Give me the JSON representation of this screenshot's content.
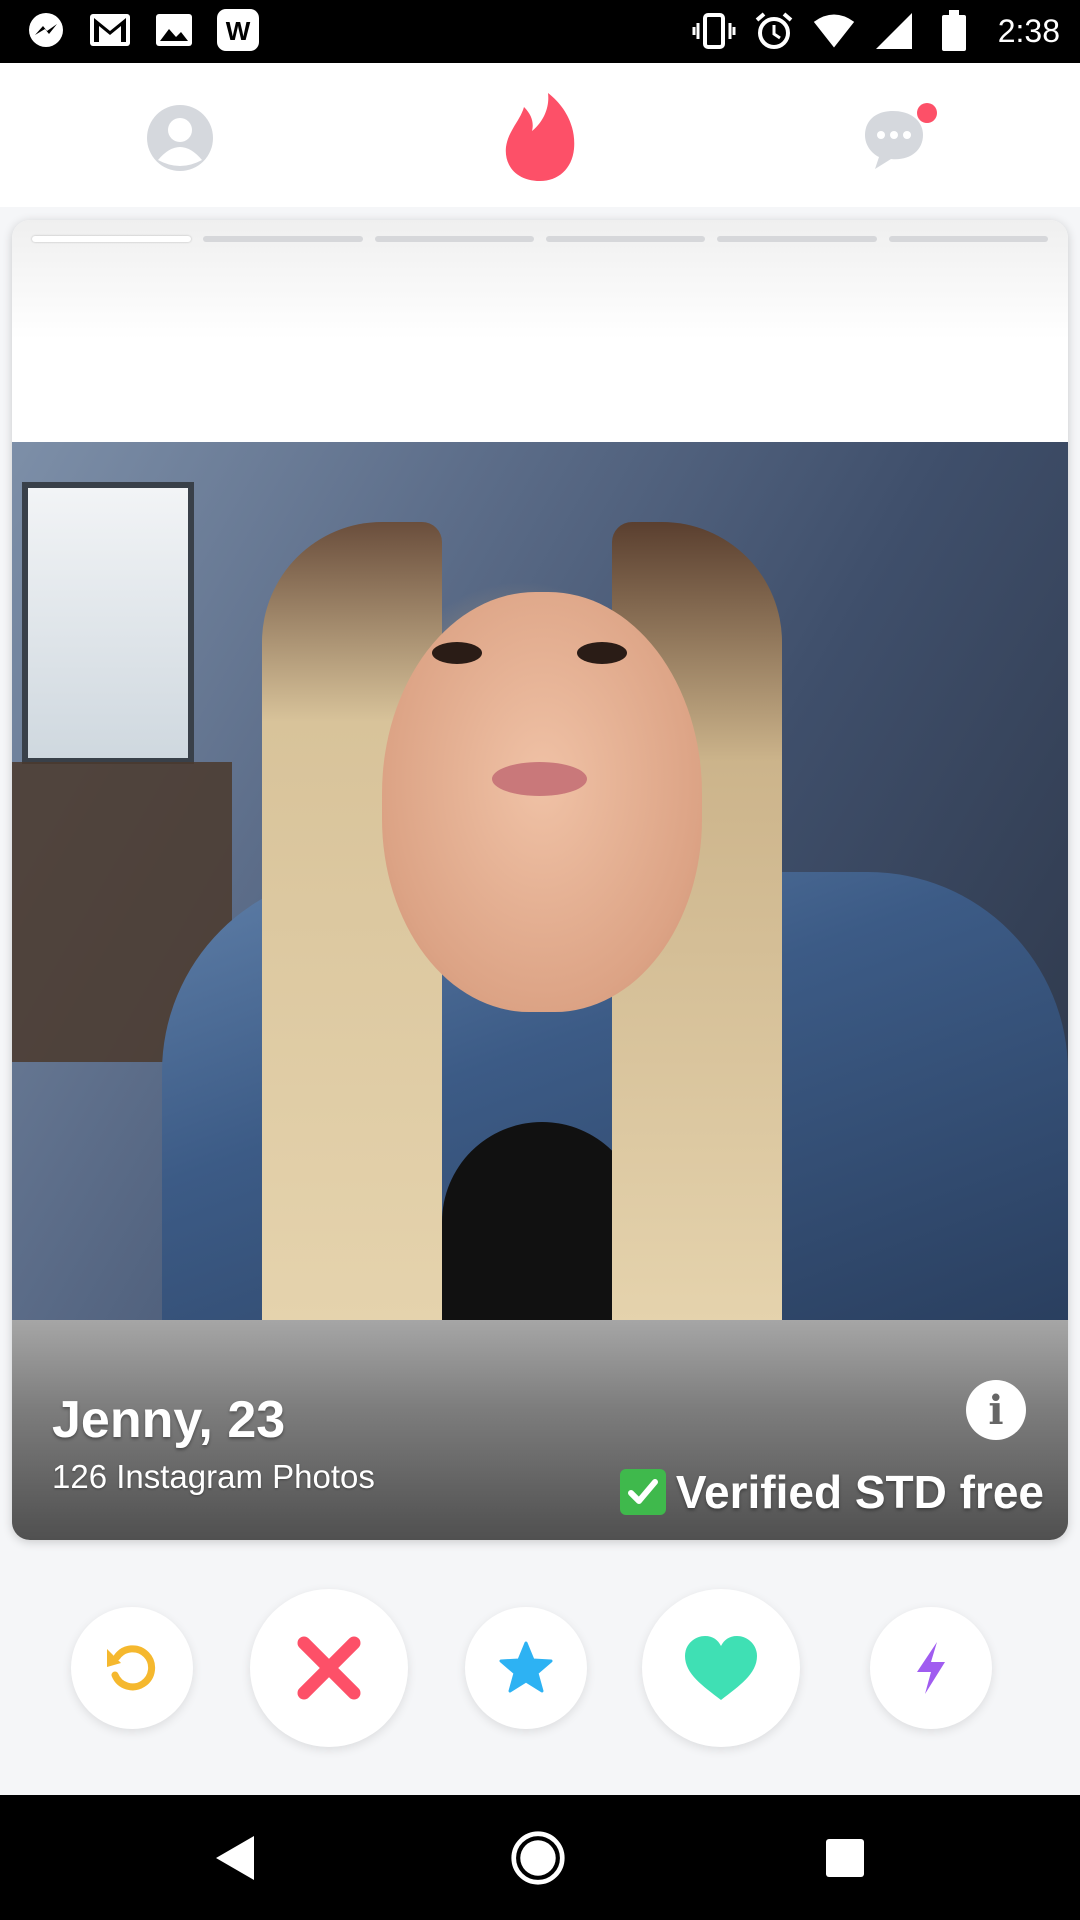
{
  "status_bar": {
    "time": "2:38",
    "left_icons": [
      "messenger-icon",
      "gmail-icon",
      "gallery-icon",
      "wikipedia-icon"
    ],
    "right_icons": [
      "vibrate-icon",
      "alarm-icon",
      "wifi-icon",
      "signal-icon",
      "battery-icon"
    ]
  },
  "top_nav": {
    "profile": "profile-icon",
    "center": "flame-icon",
    "messages": "chat-icon",
    "accent": "#fd5068",
    "inactive": "#d5d8dd"
  },
  "card": {
    "photo_index": 1,
    "photo_count": 6,
    "name_age": "Jenny, 23",
    "subtitle": "126 Instagram Photos",
    "info_label": "i",
    "verified_text": "Verified STD free"
  },
  "actions": {
    "rewind": {
      "icon": "rewind-icon",
      "color": "#f5b82e"
    },
    "nope": {
      "icon": "x-icon",
      "color": "#fd5068"
    },
    "super_like": {
      "icon": "star-icon",
      "color": "#2db2f3"
    },
    "like": {
      "icon": "heart-icon",
      "color": "#3fe0b4"
    },
    "boost": {
      "icon": "bolt-icon",
      "color": "#a05cf0"
    }
  },
  "android_nav": [
    "back-icon",
    "home-icon",
    "recents-icon"
  ]
}
